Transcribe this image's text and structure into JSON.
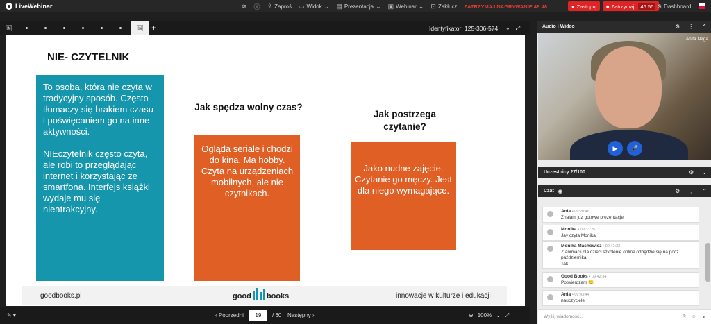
{
  "app": {
    "name": "LiveWebinar"
  },
  "topnav": {
    "invite": "Zaproś",
    "view": "Widok",
    "presentation": "Prezentacja",
    "webinar": "Webinar",
    "close": "Zakłucz",
    "recording_status": "ZATRZYMAJ NAGRYWANIE 46:48",
    "leave": "Zastopuj",
    "stop": "Zatrzymaj",
    "timer": "46:56",
    "dashboard": "Dashboard"
  },
  "presentation_toolbar": {
    "identifier": "Identyfikator: 125-306-574"
  },
  "slide": {
    "title": "NIE- CZYTELNIK",
    "box1_p1": "To osoba, która nie czyta w tradycyjny sposób. Często tłumaczy się brakiem czasu i poświęcaniem go na inne aktywności.",
    "box1_p2": "NIEczytelnik często czyta, ale robi to przeglądając internet i korzystając ze smartfona. Interfejs książki wydaje mu się nieatrakcyjny.",
    "question1": "Jak spędza wolny czas?",
    "box2": "Ogląda seriale i chodzi do kina. Ma hobby. Czyta na urządzeniach mobilnych, ale nie czytnikach.",
    "question2": "Jak postrzega czytanie?",
    "box3": "Jako nudne zajęcie. Czytanie go męczy. Jest dla niego wymagające.",
    "footer_left": "goodbooks.pl",
    "footer_logo_left": "good",
    "footer_logo_right": "books",
    "footer_right": "innowacje w kulturze i edukacji"
  },
  "bottom_toolbar": {
    "prev": "Poprzedni",
    "page": "19",
    "page_count": "/ 60",
    "next": "Następny",
    "zoom": "100%"
  },
  "right_panel": {
    "audio_video": "Audio i Wideo",
    "video_name": "Anita Nega",
    "participants": "Uczestnicy 27/100",
    "chat": "Czat",
    "messages": [
      {
        "author": "Ania",
        "time": "• 09:20:46",
        "text": "Znalam juz gotowe prezentacje"
      },
      {
        "author": "Monika",
        "time": "• 09:33:25",
        "text": "Jav czyta Monika"
      },
      {
        "author": "Monika Machowicz",
        "time": "• 09:42:23",
        "text": "Z animacji dla dzieci szkolenie online odbędzie się na pocz. października",
        "extra": "Tak"
      },
      {
        "author": "Good Books",
        "time": "• 09:42:34",
        "text": "Potwierdzam 🙂"
      },
      {
        "author": "Ania",
        "time": "• 09:43:44",
        "text": "nauczyciele"
      }
    ],
    "chat_placeholder": "Wyślij wiadomość..."
  },
  "colors": {
    "teal": "#1696ad",
    "orange": "#e05f25",
    "red": "#e02424",
    "blue": "#2260d8"
  }
}
